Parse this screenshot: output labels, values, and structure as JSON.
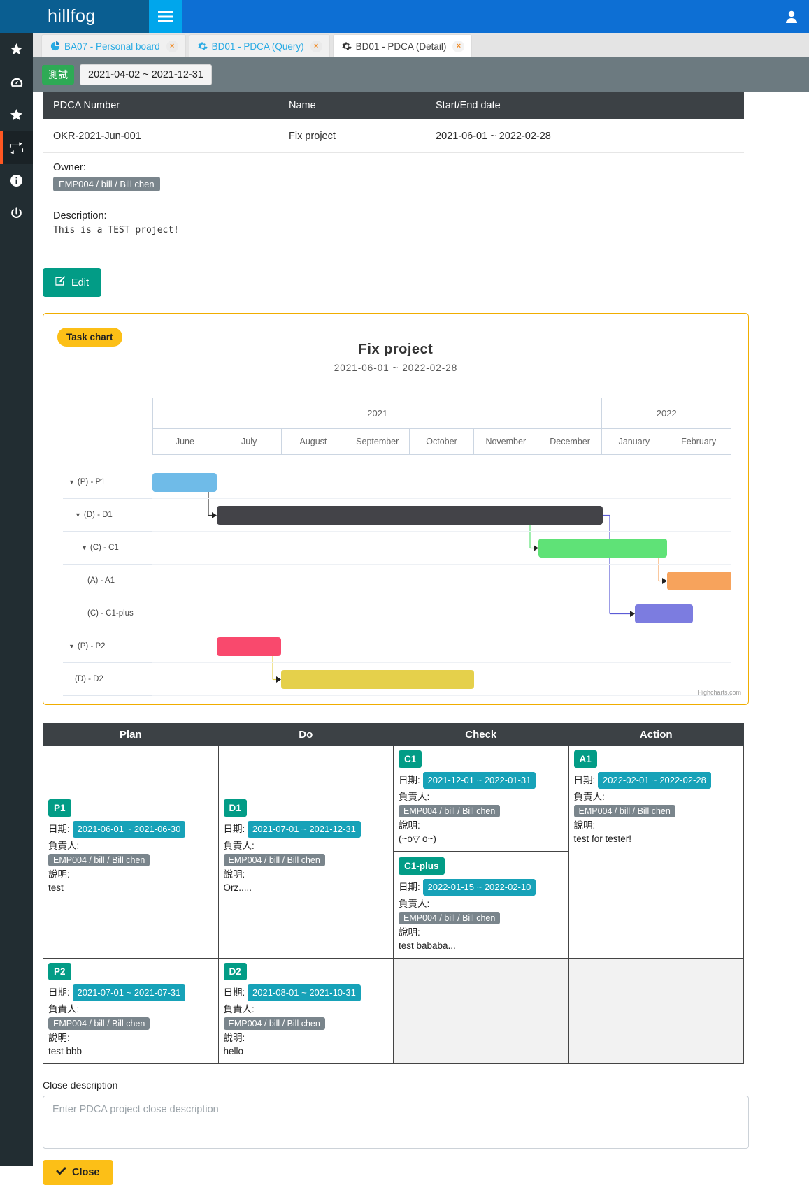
{
  "app": {
    "brand": "hillfog",
    "menu_icon": "hamburger-icon",
    "user_icon": "user-icon"
  },
  "sidebar": {
    "items": [
      {
        "name": "star",
        "icon": "star-icon"
      },
      {
        "name": "dashboard",
        "icon": "gauge-icon"
      },
      {
        "name": "favorite",
        "icon": "star-icon"
      },
      {
        "name": "pdca",
        "icon": "exchange-icon",
        "active": true
      },
      {
        "name": "info",
        "icon": "info-circle-icon"
      },
      {
        "name": "power",
        "icon": "power-icon"
      }
    ]
  },
  "tabs": [
    {
      "label": "BA07 - Personal board",
      "icon": "pie-chart-icon",
      "active": false,
      "close": "×"
    },
    {
      "label": "BD01 - PDCA (Query)",
      "icon": "gear-icon",
      "active": false,
      "close": "×"
    },
    {
      "label": "BD01 - PDCA (Detail)",
      "icon": "gear-icon",
      "active": true,
      "close": "×"
    }
  ],
  "subheader": {
    "badge": "測試",
    "date_range": "2021-04-02 ~ 2021-12-31"
  },
  "info": {
    "headers": [
      "PDCA Number",
      "Name",
      "Start/End date"
    ],
    "row": [
      "OKR-2021-Jun-001",
      "Fix project",
      "2021-06-01 ~ 2022-02-28"
    ],
    "owner_label": "Owner:",
    "owner_value": "EMP004 / bill / Bill chen",
    "description_label": "Description:",
    "description_value": "This is a TEST project!"
  },
  "actions": {
    "edit_label": "Edit",
    "edit_icon": "pencil-square-icon"
  },
  "chart_panel": {
    "tag": "Task chart",
    "credits": "Highcharts.com"
  },
  "chart_data": {
    "type": "bar",
    "subtype": "gantt",
    "title": "Fix project",
    "subtitle": "2021-06-01 ~ 2022-02-28",
    "xlabel": "",
    "ylabel": "",
    "grid": true,
    "legend": "none",
    "axis_top": [
      {
        "label": "2021",
        "months": 7
      },
      {
        "label": "2022",
        "months": 2
      }
    ],
    "categories": [
      "June",
      "July",
      "August",
      "September",
      "October",
      "November",
      "December",
      "January",
      "February"
    ],
    "tasks": [
      {
        "name": "(P) - P1",
        "level": 0,
        "collapsible": true,
        "start": "2021-06-01",
        "end": "2021-06-30",
        "color": "#6fbbe8",
        "start_month_index": 0.0,
        "end_month_index": 1.0
      },
      {
        "name": "(D) - D1",
        "level": 1,
        "collapsible": true,
        "start": "2021-07-01",
        "end": "2021-12-31",
        "color": "#434348",
        "start_month_index": 1.0,
        "end_month_index": 7.0
      },
      {
        "name": "(C) - C1",
        "level": 2,
        "collapsible": true,
        "start": "2021-12-01",
        "end": "2022-01-31",
        "color": "#5fe277",
        "start_month_index": 6.0,
        "end_month_index": 8.0
      },
      {
        "name": "(A) - A1",
        "level": 3,
        "collapsible": false,
        "start": "2022-02-01",
        "end": "2022-02-28",
        "color": "#f7a35c",
        "start_month_index": 8.0,
        "end_month_index": 9.0
      },
      {
        "name": "(C) - C1-plus",
        "level": 3,
        "collapsible": false,
        "start": "2022-01-15",
        "end": "2022-02-10",
        "color": "#7c7ce0",
        "start_month_index": 7.5,
        "end_month_index": 8.4
      },
      {
        "name": "(P) - P2",
        "level": 0,
        "collapsible": true,
        "start": "2021-07-01",
        "end": "2021-07-31",
        "color": "#f9496d",
        "start_month_index": 1.0,
        "end_month_index": 2.0
      },
      {
        "name": "(D) - D2",
        "level": 1,
        "collapsible": false,
        "start": "2021-08-01",
        "end": "2021-10-31",
        "color": "#e5d04b",
        "start_month_index": 2.0,
        "end_month_index": 5.0
      }
    ],
    "dependencies": [
      {
        "from": "(P) - P1",
        "to": "(D) - D1",
        "color": "#333333"
      },
      {
        "from": "(D) - D1",
        "to": "(C) - C1-plus",
        "color": "#5b5bd6"
      },
      {
        "from": "(C) - C1",
        "to": "(A) - A1",
        "color": "#f7a35c"
      },
      {
        "from": "(D) - D1",
        "to": "(C) - C1",
        "color": "#5fe277"
      },
      {
        "from": "(P) - P2",
        "to": "(D) - D2",
        "color": "#e5d04b"
      }
    ]
  },
  "pdca_table": {
    "headers": [
      "Plan",
      "Do",
      "Check",
      "Action"
    ],
    "field_labels": {
      "date": "日期:",
      "owner": "負責人:",
      "desc": "說明:"
    },
    "rows": [
      {
        "plan": [
          {
            "tag": "P1",
            "date": "2021-06-01 ~ 2021-06-30",
            "owner": "EMP004 / bill / Bill chen",
            "desc": "test"
          }
        ],
        "do": [
          {
            "tag": "D1",
            "date": "2021-07-01 ~ 2021-12-31",
            "owner": "EMP004 / bill / Bill chen",
            "desc": "Orz....."
          }
        ],
        "check": [
          {
            "tag": "C1",
            "date": "2021-12-01 ~ 2022-01-31",
            "owner": "EMP004 / bill / Bill chen",
            "desc": "(~o▽ o~)"
          },
          {
            "tag": "C1-plus",
            "date": "2022-01-15 ~ 2022-02-10",
            "owner": "EMP004 / bill / Bill chen",
            "desc": "test bababa..."
          }
        ],
        "action": [
          {
            "tag": "A1",
            "date": "2022-02-01 ~ 2022-02-28",
            "owner": "EMP004 / bill / Bill chen",
            "desc": "test for tester!"
          }
        ]
      },
      {
        "plan": [
          {
            "tag": "P2",
            "date": "2021-07-01 ~ 2021-07-31",
            "owner": "EMP004 / bill / Bill chen",
            "desc": "test bbb"
          }
        ],
        "do": [
          {
            "tag": "D2",
            "date": "2021-08-01 ~ 2021-10-31",
            "owner": "EMP004 / bill / Bill chen",
            "desc": "hello"
          }
        ],
        "check": [],
        "action": []
      }
    ]
  },
  "close_section": {
    "label": "Close description",
    "placeholder": "Enter PDCA project close description",
    "value": "",
    "button_label": "Close",
    "button_icon": "check-icon"
  },
  "colors": {
    "topbar": "#0d6fd4",
    "brand_bg": "#0a5e91",
    "hamburger_bg": "#00a6ec",
    "sidebar": "#222d32",
    "accent_orange": "#ff5722",
    "teal": "#029c86",
    "yellow": "#fcbf17",
    "dark_head": "#3c4145",
    "subheader": "#6c7a80"
  }
}
